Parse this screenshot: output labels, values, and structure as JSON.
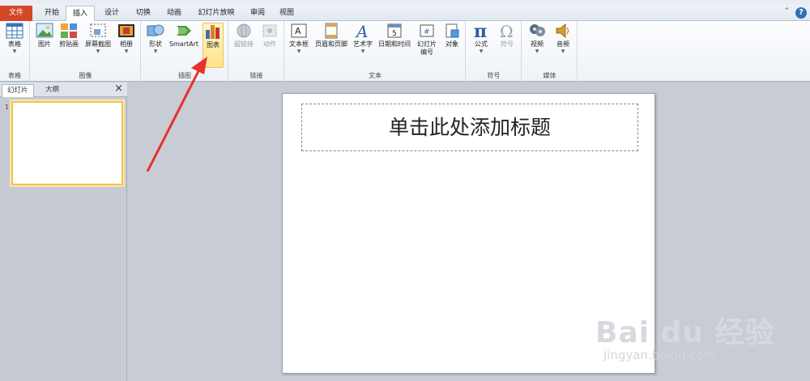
{
  "tabs": {
    "file": "文件",
    "items": [
      "开始",
      "插入",
      "设计",
      "切换",
      "动画",
      "幻灯片放映",
      "审阅",
      "视图"
    ],
    "active": "插入"
  },
  "ribbon": {
    "groups": {
      "tables": {
        "label": "表格",
        "buttons": {
          "table": "表格"
        }
      },
      "images": {
        "label": "图像",
        "buttons": {
          "picture": "图片",
          "clipart": "剪贴画",
          "screenshot": "屏幕截图",
          "album": "相册"
        }
      },
      "illustrations": {
        "label": "插图",
        "buttons": {
          "shapes": "形状",
          "smartart": "SmartArt",
          "chart": "图表"
        }
      },
      "links": {
        "label": "链接",
        "buttons": {
          "hyperlink": "超链接",
          "action": "动作"
        }
      },
      "text": {
        "label": "文本",
        "buttons": {
          "textbox": "文本框",
          "header_footer": "页眉和页脚",
          "wordart": "艺术字",
          "datetime": "日期和时间",
          "slide_number_1": "幻灯片",
          "slide_number_2": "编号",
          "object": "对象"
        }
      },
      "symbols": {
        "label": "符号",
        "buttons": {
          "equation": "公式",
          "symbol": "符号"
        }
      },
      "media": {
        "label": "媒体",
        "buttons": {
          "video": "视频",
          "audio": "音频"
        }
      }
    }
  },
  "left_pane": {
    "tab_slides": "幻灯片",
    "tab_outline": "大纲",
    "thumbnail_number": "1"
  },
  "slide": {
    "title_placeholder": "单击此处添加标题"
  },
  "watermark": {
    "logo": "Bai du 经验",
    "site": "jingyan.baidu.com"
  },
  "colors": {
    "file_tab": "#d24726",
    "highlight": "#ffe38a",
    "arrow": "#e8302c"
  }
}
